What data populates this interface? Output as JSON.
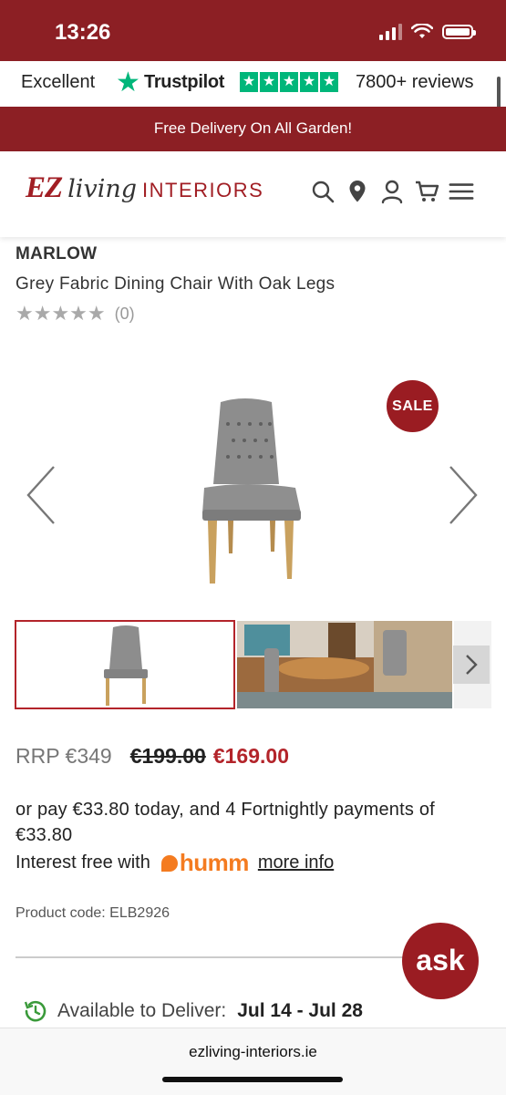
{
  "status_bar": {
    "time": "13:26"
  },
  "trustpilot": {
    "rating_word": "Excellent",
    "brand": "Trustpilot",
    "reviews": "7800+ reviews",
    "star_color": "#00b67a"
  },
  "promo": {
    "text": "Free Delivery On All Garden!"
  },
  "header": {
    "logo": {
      "ez": "EZ",
      "living": "living",
      "interiors": "INTERIORS"
    },
    "icons": [
      "search-icon",
      "location-icon",
      "account-icon",
      "cart-icon",
      "menu-icon"
    ]
  },
  "product": {
    "brand": "MARLOW",
    "title": "Grey Fabric Dining Chair With Oak Legs",
    "rating_stars": 0,
    "review_count": "(0)",
    "sale_badge": "SALE",
    "rrp": "RRP €349",
    "old_price": "€199.00",
    "price": "€169.00",
    "pay_text": "or pay €33.80 today, and 4 Fortnightly payments of €33.80",
    "interest_text": "Interest free with",
    "humm_brand": "humm",
    "more_info": "more info",
    "product_code": "Product code: ELB2926",
    "delivery_label": "Available to Deliver:",
    "delivery_dates": "Jul 14 - Jul 28"
  },
  "chat": {
    "label": "ask"
  },
  "browser": {
    "url": "ezliving-interiors.ie"
  },
  "colors": {
    "brand": "#8c1f24",
    "sale": "#b3242a",
    "humm": "#f47b20"
  }
}
